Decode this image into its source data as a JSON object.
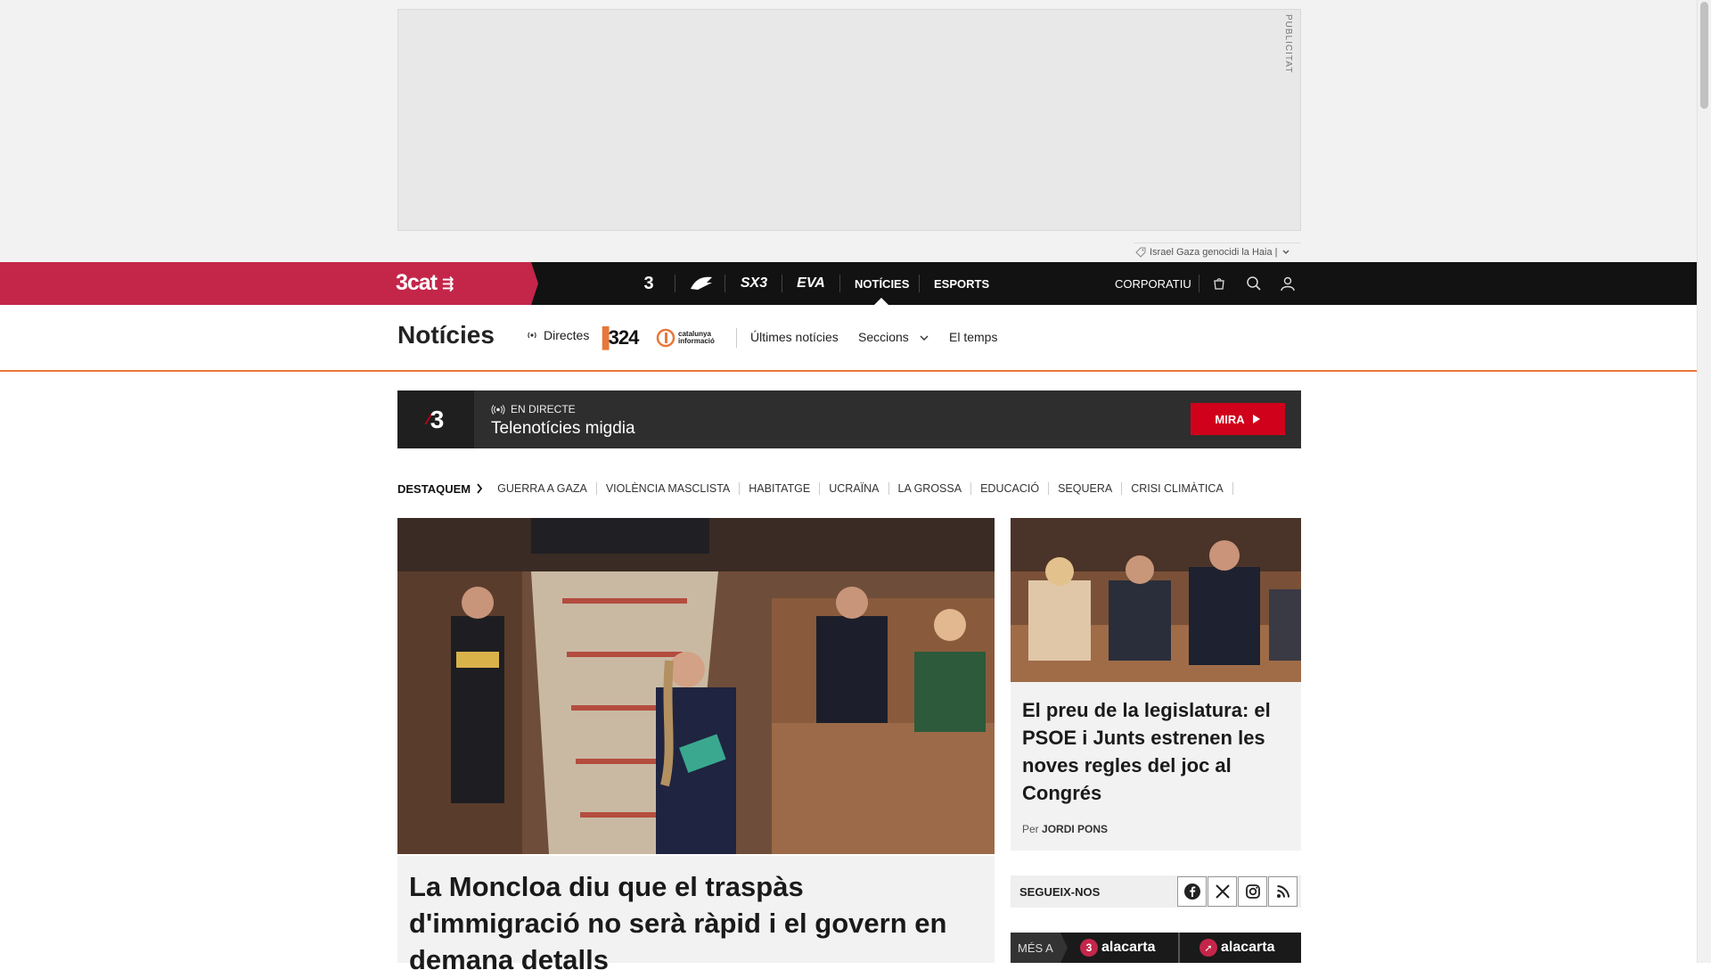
{
  "ad": {
    "label": "PUBLICITAT",
    "topics_text": "Israel Gaza genocidi la Haia |"
  },
  "topbar": {
    "logo": "3cat",
    "channels": [
      "3",
      "Cat Ràdio",
      "SX3",
      "EVA"
    ],
    "nav": {
      "noticies": "NOTÍCIES",
      "esports": "ESPORTS",
      "corporatiu": "CORPORATIU"
    }
  },
  "section": {
    "title": "Notícies",
    "directes": "Directes",
    "brand_324": "324",
    "brand_ci": "catalunya informació",
    "ultimes": "Últimes notícies",
    "seccions": "Seccions",
    "temps": "El temps"
  },
  "live": {
    "badge": "EN DIRECTE",
    "program": "Telenotícies migdia",
    "button": "MIRA"
  },
  "destaquem": {
    "label": "DESTAQUEM",
    "tags": [
      "GUERRA A GAZA",
      "VIOLÈNCIA MASCLISTA",
      "HABITATGE",
      "UCRAÏNA",
      "LA GROSSA",
      "EDUCACIÓ",
      "SEQUERA",
      "CRISI CLIMÀTICA"
    ]
  },
  "main_story": {
    "headline": "La Moncloa diu que el traspàs d'immigració no serà ràpid i el govern en demana detalls"
  },
  "side_story": {
    "headline": "El preu de la legislatura: el PSOE i Junts estrenen les noves regles del joc al Congrés",
    "by_prefix": "Per",
    "author": "JORDI PONS"
  },
  "follow": {
    "label": "SEGUEIX-NOS",
    "networks": [
      "facebook-icon",
      "x-icon",
      "instagram-icon",
      "rss-icon"
    ]
  },
  "mesa": {
    "label": "MÉS A",
    "brand1": "alacarta",
    "brand2": "alacarta"
  },
  "colors": {
    "brand_red": "#c4264a",
    "live_red": "#d0011b",
    "orange_rule": "#e8773a",
    "dark": "#121212"
  }
}
